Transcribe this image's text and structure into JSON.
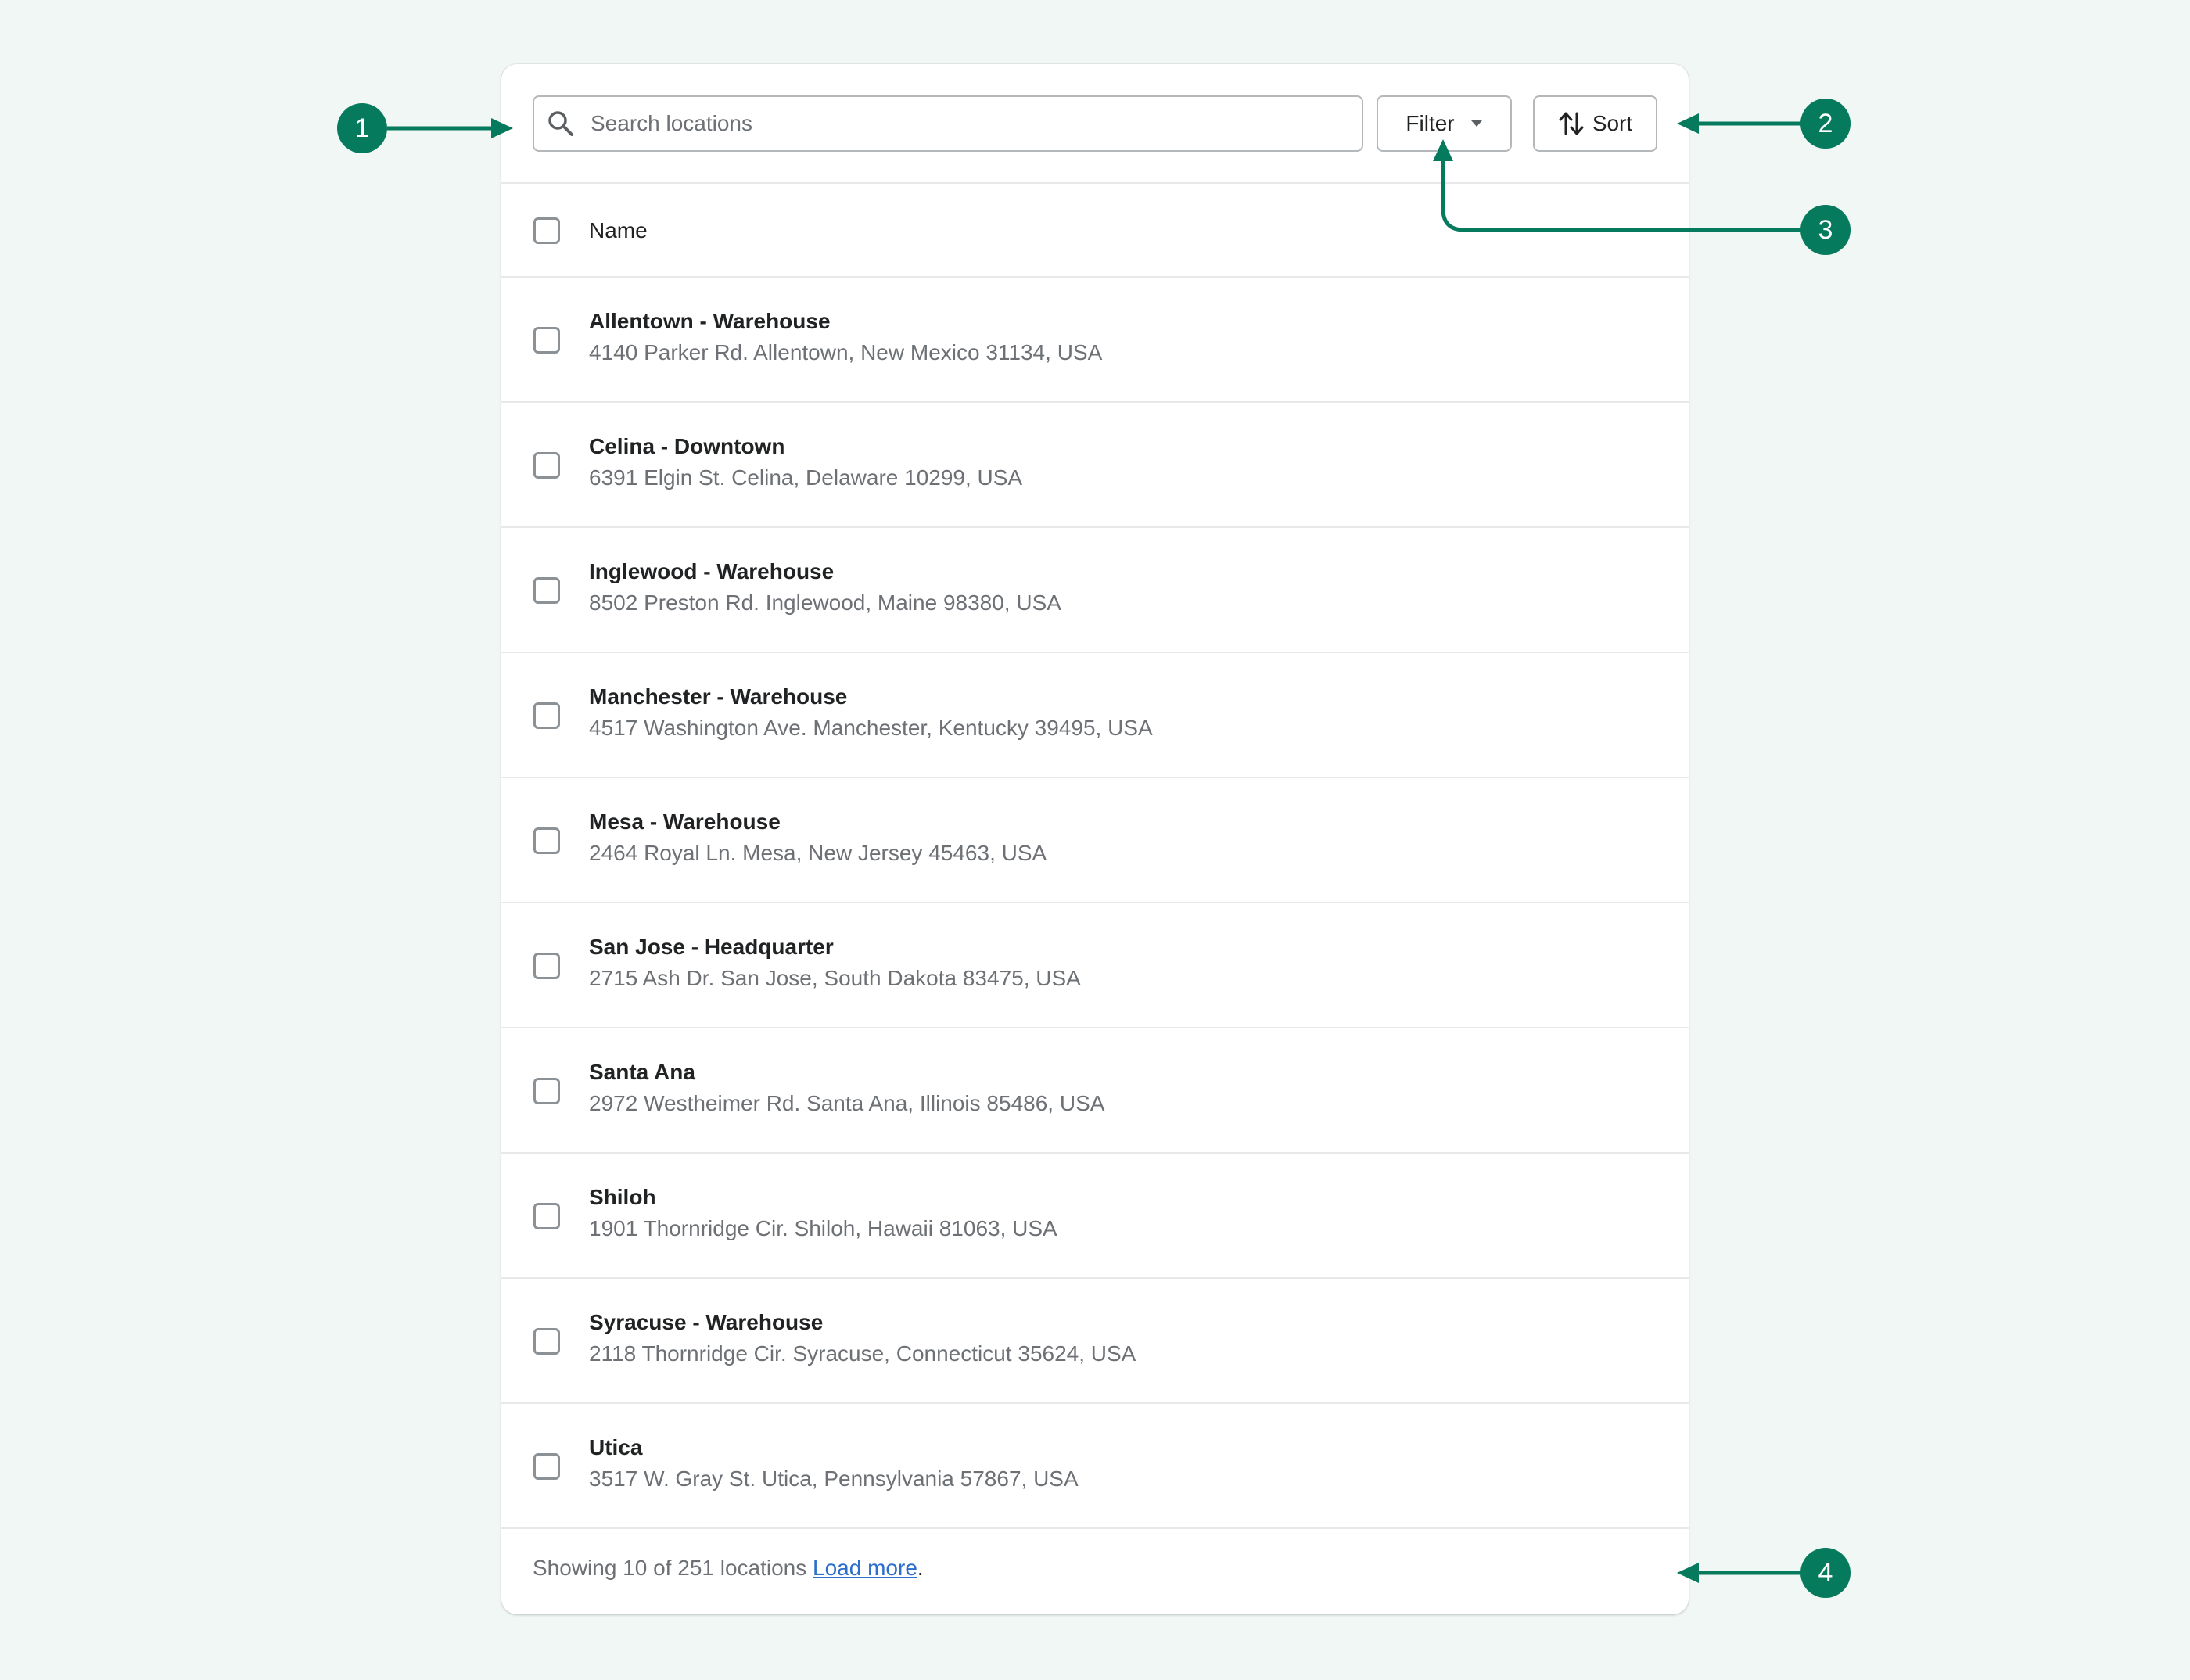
{
  "search": {
    "placeholder": "Search locations",
    "icon": "search-icon"
  },
  "toolbar": {
    "filter_label": "Filter",
    "sort_label": "Sort"
  },
  "table": {
    "header_name": "Name",
    "rows": [
      {
        "name": "Allentown - Warehouse",
        "address": "4140 Parker Rd. Allentown, New Mexico 31134, USA"
      },
      {
        "name": "Celina - Downtown",
        "address": "6391 Elgin St. Celina, Delaware 10299, USA"
      },
      {
        "name": "Inglewood - Warehouse",
        "address": "8502 Preston Rd. Inglewood, Maine 98380, USA"
      },
      {
        "name": "Manchester - Warehouse",
        "address": "4517 Washington Ave. Manchester, Kentucky 39495, USA"
      },
      {
        "name": "Mesa - Warehouse",
        "address": "2464 Royal Ln. Mesa, New Jersey 45463, USA"
      },
      {
        "name": "San Jose - Headquarter",
        "address": "2715 Ash Dr. San Jose, South Dakota 83475, USA"
      },
      {
        "name": "Santa Ana",
        "address": "2972 Westheimer Rd. Santa Ana, Illinois 85486, USA"
      },
      {
        "name": "Shiloh",
        "address": "1901 Thornridge Cir. Shiloh, Hawaii 81063, USA"
      },
      {
        "name": "Syracuse - Warehouse",
        "address": "2118 Thornridge Cir. Syracuse, Connecticut 35624, USA"
      },
      {
        "name": "Utica",
        "address": "3517 W. Gray St. Utica, Pennsylvania 57867, USA"
      }
    ]
  },
  "footer": {
    "text": "Showing 10 of 251 locations ",
    "link": "Load more",
    "period": "."
  },
  "annotations": {
    "badge_1": "1",
    "badge_2": "2",
    "badge_3": "3",
    "badge_4": "4",
    "color": "#067a5c"
  },
  "colors": {
    "background": "#f1f7f4",
    "link": "#2c6ecb",
    "accent": "#067a5c"
  }
}
